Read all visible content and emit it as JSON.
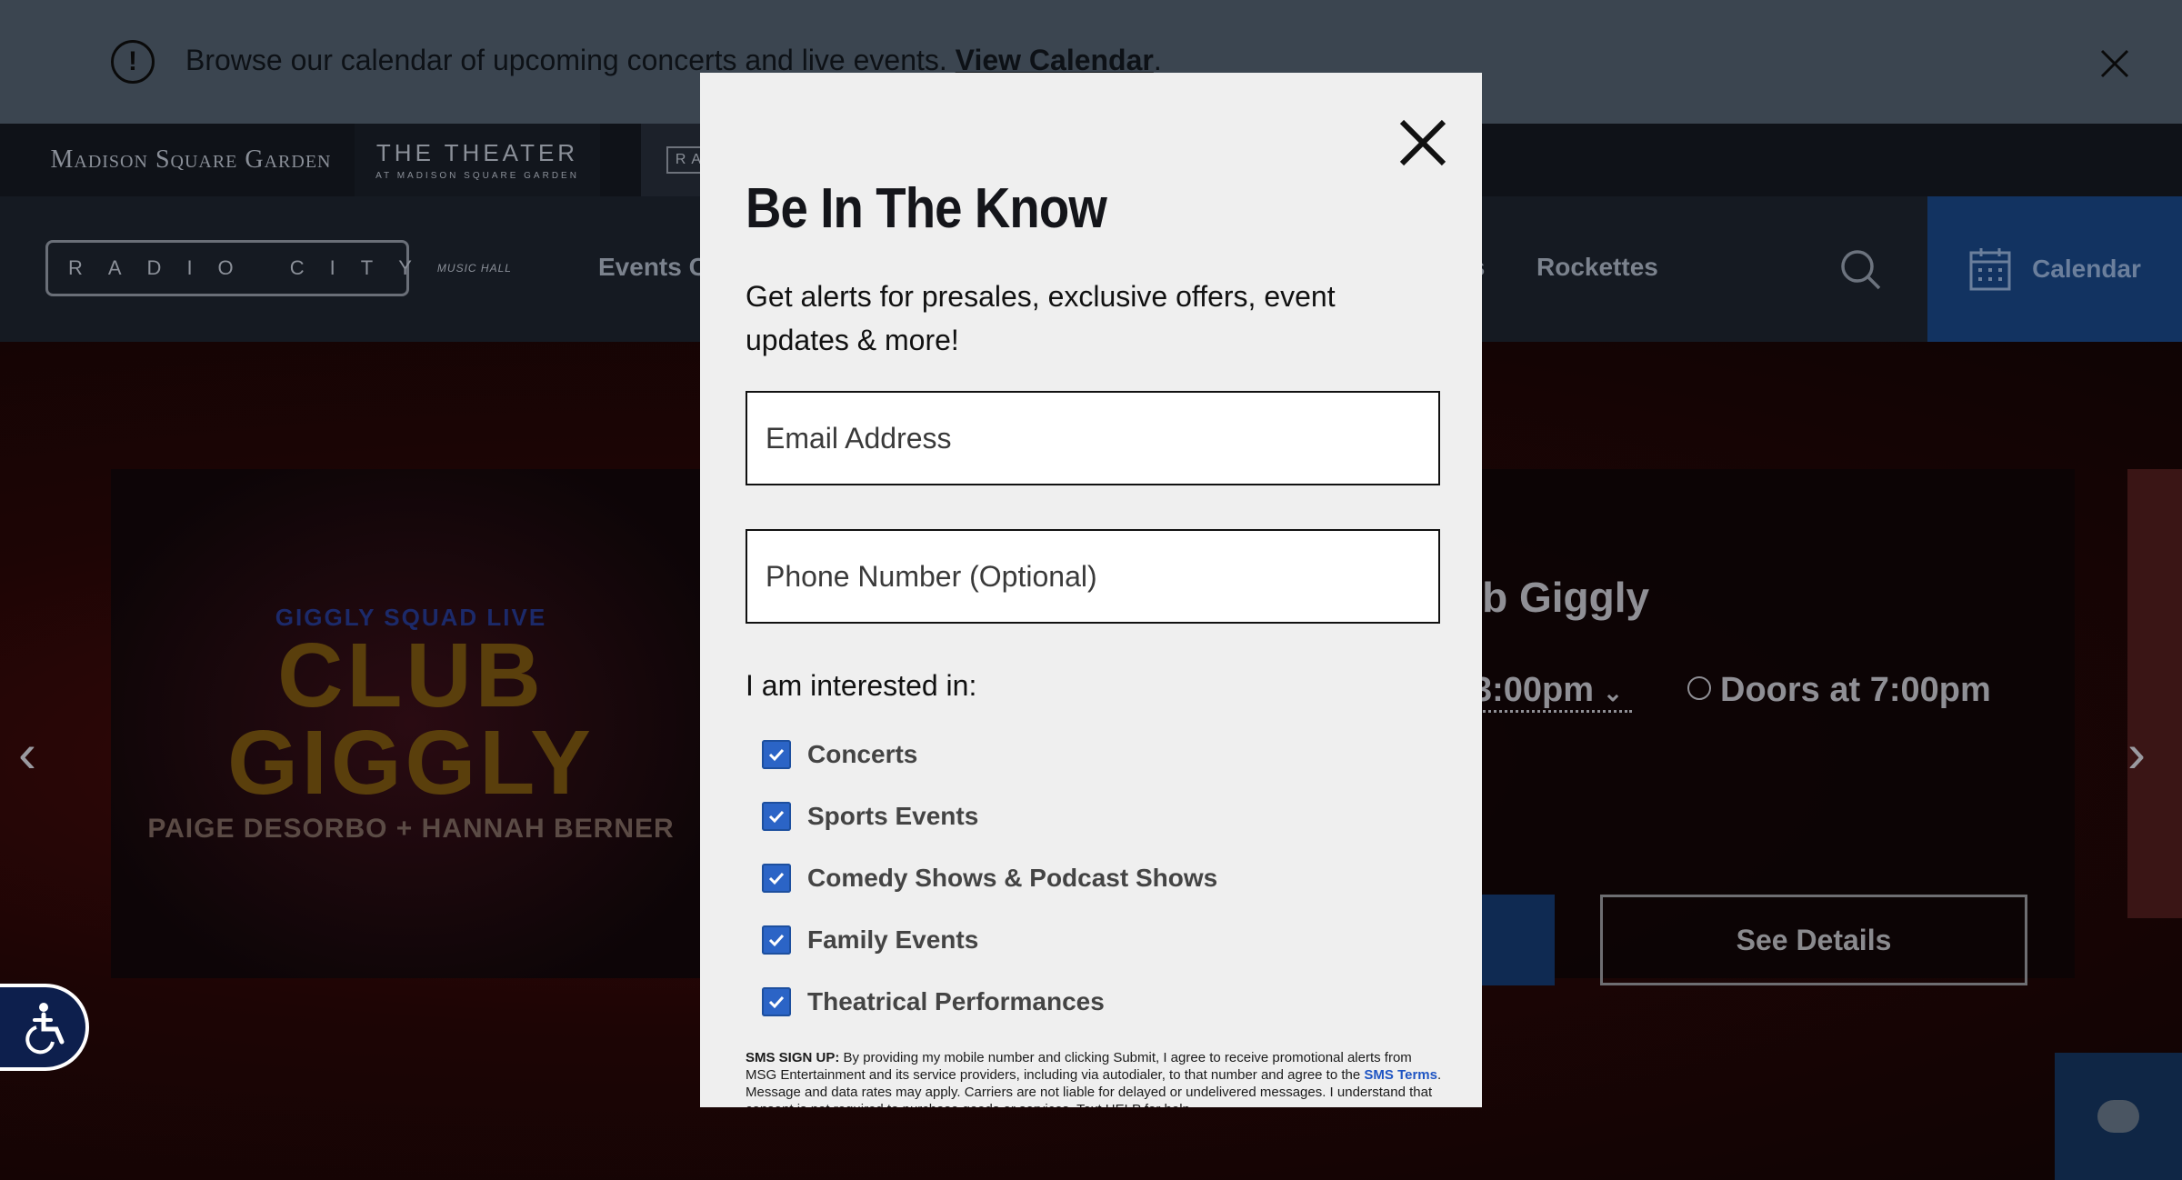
{
  "announcement": {
    "text": "Browse our calendar of upcoming concerts and live events.",
    "link": "View Calendar",
    "period": "."
  },
  "venues": {
    "msg": "Madison Square Garden",
    "theater_title": "THE THEATER",
    "theater_sub": "AT MADISON SQUARE GARDEN",
    "radio": "RA"
  },
  "logo": {
    "text": "RADIO CITY",
    "small": "MUSIC HALL"
  },
  "nav": {
    "events": "Events C",
    "deals": "ls",
    "rockettes": "Rockettes",
    "calendar": "Calendar"
  },
  "hero": {
    "art_sub": "GIGGLY SQUAD LIVE",
    "art_title": "CLUB GIGGLY",
    "art_names": "PAIGE DESORBO + HANNAH BERNER",
    "event_name": "ub Giggly",
    "event_time": "3:00pm",
    "doors": "Doors at 7:00pm",
    "details_button": "See Details"
  },
  "modal": {
    "title": "Be In The Know",
    "description": "Get alerts for presales, exclusive offers, event updates & more!",
    "email_placeholder": "Email Address",
    "phone_placeholder": "Phone Number (Optional)",
    "interest_label": "I am interested in:",
    "interests": [
      {
        "label": "Concerts",
        "checked": true
      },
      {
        "label": "Sports Events",
        "checked": true
      },
      {
        "label": "Comedy Shows & Podcast Shows",
        "checked": true
      },
      {
        "label": "Family Events",
        "checked": true
      },
      {
        "label": "Theatrical Performances",
        "checked": true
      }
    ],
    "sms_heading": "SMS SIGN UP:",
    "sms_text_1": "By providing my mobile number and clicking Submit, I agree to receive promotional alerts from MSG Entertainment and its service providers, including via autodialer, to that number and agree to the",
    "sms_terms_link": "SMS Terms",
    "sms_text_2": ". Message and data rates may apply. Carriers are not liable for delayed or undelivered messages. I understand that consent is not required to purchase goods or services. Text HELP for help."
  },
  "colors": {
    "accent": "#2b64c6",
    "announcement_bg": "#3b4550",
    "calendar_bg": "#123361"
  }
}
